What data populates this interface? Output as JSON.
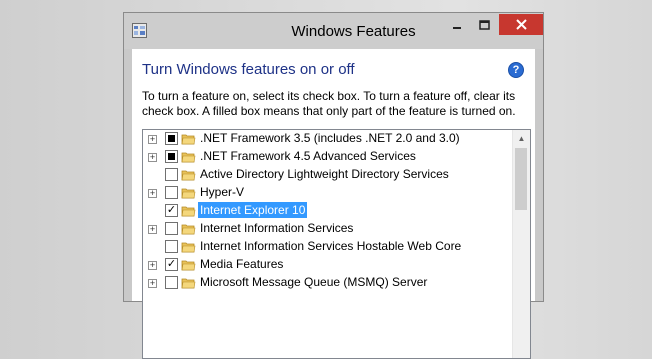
{
  "window": {
    "title": "Windows Features",
    "icon": "windows-features-icon",
    "controls": [
      "minimize-icon",
      "maximize-icon",
      "close-icon"
    ]
  },
  "heading": "Turn Windows features on or off",
  "help_icon": "?",
  "description": "To turn a feature on, select its check box. To turn a feature off, clear its check box. A filled box means that only part of the feature is turned on.",
  "features": [
    {
      "label": ".NET Framework 3.5 (includes .NET 2.0 and 3.0)",
      "expandable": true,
      "state": "partial",
      "selected": false
    },
    {
      "label": ".NET Framework 4.5 Advanced Services",
      "expandable": true,
      "state": "partial",
      "selected": false
    },
    {
      "label": "Active Directory Lightweight Directory Services",
      "expandable": false,
      "state": "unchecked",
      "selected": false
    },
    {
      "label": "Hyper-V",
      "expandable": true,
      "state": "unchecked",
      "selected": false
    },
    {
      "label": "Internet Explorer 10",
      "expandable": false,
      "state": "checked",
      "selected": true
    },
    {
      "label": "Internet Information Services",
      "expandable": true,
      "state": "unchecked",
      "selected": false
    },
    {
      "label": "Internet Information Services Hostable Web Core",
      "expandable": false,
      "state": "unchecked",
      "selected": false
    },
    {
      "label": "Media Features",
      "expandable": true,
      "state": "checked",
      "selected": false
    },
    {
      "label": "Microsoft Message Queue (MSMQ) Server",
      "expandable": true,
      "state": "unchecked",
      "selected": false
    }
  ],
  "colors": {
    "heading": "#1e3287",
    "selection": "#3399ff",
    "close_button": "#c7372f",
    "folder": "#e8c25a"
  }
}
